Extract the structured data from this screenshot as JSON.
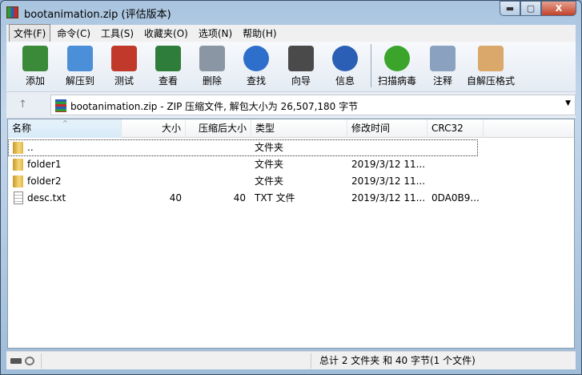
{
  "window": {
    "title": "bootanimation.zip (评估版本)",
    "min": "▬",
    "max": "▢",
    "close": "X"
  },
  "menu": [
    "文件(F)",
    "命令(C)",
    "工具(S)",
    "收藏夹(O)",
    "选项(N)",
    "帮助(H)"
  ],
  "toolbar": [
    {
      "label": "添加",
      "icon": "add-archive-icon",
      "color": "#3a8a3a"
    },
    {
      "label": "解压到",
      "icon": "extract-folder-icon",
      "color": "#4a8fd8"
    },
    {
      "label": "测试",
      "icon": "test-clipboard-icon",
      "color": "#c0392b"
    },
    {
      "label": "查看",
      "icon": "view-book-icon",
      "color": "#2f7d3a"
    },
    {
      "label": "删除",
      "icon": "trash-icon",
      "color": "#8a96a3"
    },
    {
      "label": "查找",
      "icon": "magnifier-icon",
      "color": "#2f6fcc"
    },
    {
      "label": "向导",
      "icon": "wizard-wand-icon",
      "color": "#4a4a4a"
    },
    {
      "label": "信息",
      "icon": "info-icon",
      "color": "#2a5fb5"
    },
    {
      "label": "扫描病毒",
      "icon": "virus-scan-icon",
      "color": "#3aa52a"
    },
    {
      "label": "注释",
      "icon": "comment-icon",
      "color": "#8aa2bf"
    },
    {
      "label": "自解压格式",
      "icon": "sfx-box-icon",
      "color": "#d9a86a"
    }
  ],
  "address": {
    "up": "↑",
    "text": "bootanimation.zip - ZIP 压缩文件, 解包大小为 26,507,180 字节",
    "dropdown": "▼"
  },
  "columns": {
    "name": "名称",
    "size": "大小",
    "packed": "压缩后大小",
    "type": "类型",
    "modified": "修改时间",
    "crc": "CRC32",
    "sort_indicator": "^"
  },
  "rows": [
    {
      "name": "..",
      "size": "",
      "packed": "",
      "type": "文件夹",
      "modified": "",
      "crc": "",
      "kind": "folder"
    },
    {
      "name": "folder1",
      "size": "",
      "packed": "",
      "type": "文件夹",
      "modified": "2019/3/12 11...",
      "crc": "",
      "kind": "folder"
    },
    {
      "name": "folder2",
      "size": "",
      "packed": "",
      "type": "文件夹",
      "modified": "2019/3/12 11...",
      "crc": "",
      "kind": "folder"
    },
    {
      "name": "desc.txt",
      "size": "40",
      "packed": "40",
      "type": "TXT 文件",
      "modified": "2019/3/12 11...",
      "crc": "0DA0B9...",
      "kind": "file"
    }
  ],
  "status": {
    "summary": "总计 2 文件夹 和 40 字节(1 个文件)"
  }
}
